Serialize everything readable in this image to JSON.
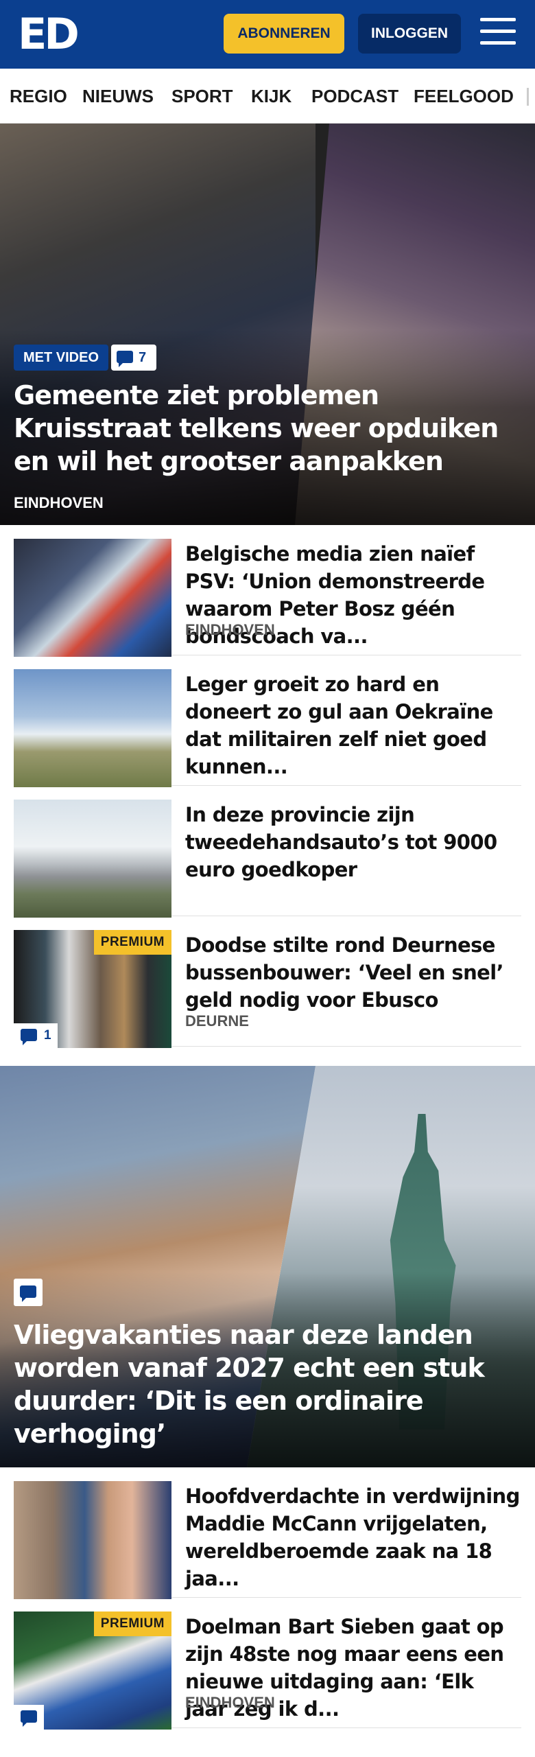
{
  "header": {
    "logo": "ED",
    "subscribe_label": "ABONNEREN",
    "login_label": "INLOGGEN"
  },
  "nav": {
    "items": [
      "REGIO",
      "NIEUWS",
      "SPORT",
      "KIJK",
      "PODCAST",
      "FEELGOOD"
    ]
  },
  "hero": {
    "badge": "MET VIDEO",
    "comment_count": "7",
    "title": "Gemeente ziet problemen Kruisstraat telkens weer opduiken en wil het grootser aanpakken",
    "kicker": "EINDHOVEN"
  },
  "articles": [
    {
      "title": "Belgische media zien naïef PSV: ‘Union demonstreerde waarom Peter Bosz géén bondscoach va...",
      "kicker": "EINDHOVEN"
    },
    {
      "title": "Leger groeit zo hard en doneert zo gul aan Oekraïne dat militairen zelf niet goed kunnen...",
      "kicker": ""
    },
    {
      "title": "In deze provincie zijn tweedehandsauto’s tot 9000 euro goedkoper",
      "kicker": ""
    },
    {
      "title": "Doodse stilte rond Deurnese bussenbouwer: ‘Veel en snel’ geld nodig voor Ebusco",
      "kicker": "DEURNE",
      "premium": "PREMIUM",
      "comment_count": "1"
    }
  ],
  "feature": {
    "title": "Vliegvakanties naar deze landen worden vanaf 2027 echt een stuk duurder: ‘Dit is een ordinaire verhoging’"
  },
  "articles2": [
    {
      "title": "Hoofdverdachte in verdwijning Maddie McCann vrijgelaten, wereldberoemde zaak na 18 jaa...",
      "kicker": ""
    },
    {
      "title": "Doelman Bart Sieben gaat op zijn 48ste nog maar eens een nieuwe uitdaging aan: ‘Elk jaar zeg ik d...",
      "kicker": "EINDHOVEN",
      "premium": "PREMIUM"
    }
  ],
  "colors": {
    "brand_blue": "#0b3f8f",
    "subscribe_yellow": "#f4c12a",
    "premium_yellow": "#f4c12a"
  }
}
